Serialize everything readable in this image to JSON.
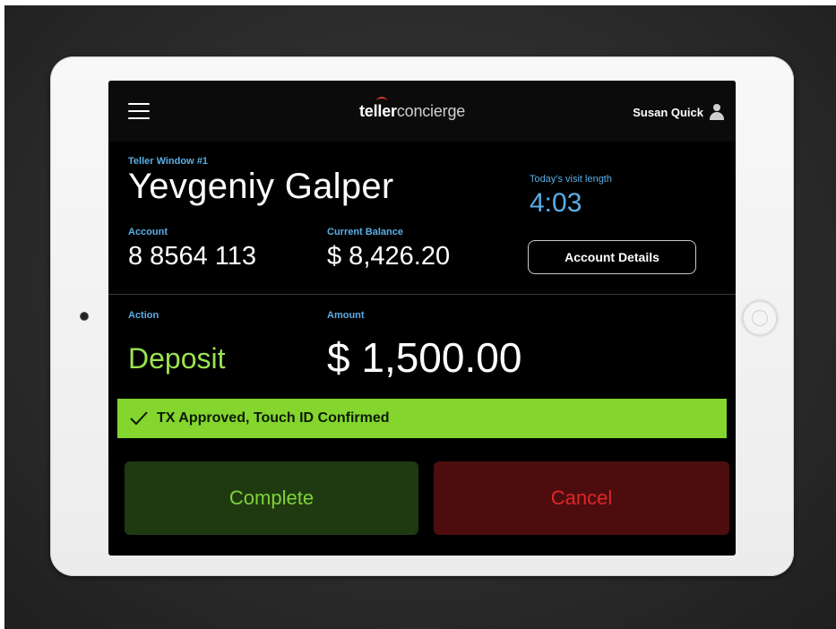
{
  "app": {
    "logo_bold": "teller",
    "logo_light": "concierge",
    "user_name": "Susan Quick"
  },
  "customer": {
    "window_label": "Teller Window #1",
    "name": "Yevgeniy Galper",
    "visit_label": "Today's visit length",
    "visit_time": "4:03",
    "account_label": "Account",
    "account_number": "8 8564 113",
    "balance_label": "Current Balance",
    "balance": "$ 8,426.20",
    "account_details_button": "Account Details"
  },
  "transaction": {
    "action_label": "Action",
    "action": "Deposit",
    "amount_label": "Amount",
    "amount": "$ 1,500.00",
    "status": "TX Approved, Touch ID Confirmed"
  },
  "buttons": {
    "complete": "Complete",
    "cancel": "Cancel"
  },
  "colors": {
    "accent_blue": "#5aaee6",
    "approved_green": "#84d62f",
    "complete_bg": "#1f3a10",
    "cancel_bg": "#4d0d0e",
    "cancel_text": "#e0262a"
  },
  "icons": [
    "hamburger-icon",
    "user-icon",
    "checkmark-icon"
  ]
}
